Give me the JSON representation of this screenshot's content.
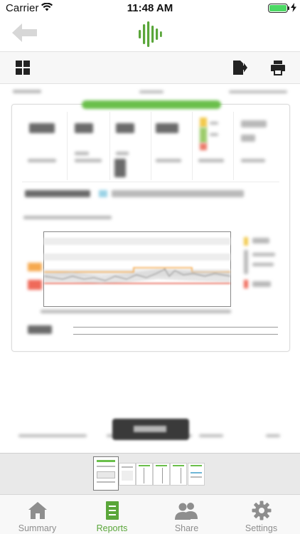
{
  "status_bar": {
    "carrier": "Carrier",
    "time": "11:48 AM",
    "battery_level": 1.0,
    "battery_color": "#4cd964"
  },
  "nav": {
    "back_icon": "back-arrow-icon",
    "logo_icon": "sound-bars-logo-icon",
    "logo_color": "#5aa63a"
  },
  "toolbar": {
    "grid_icon": "grid-view-icon",
    "export_icon": "export-document-icon",
    "print_icon": "printer-icon"
  },
  "document": {
    "blurred": true,
    "accent_color": "#6abf4b"
  },
  "thumbnails": {
    "count": 6,
    "selected_index": 0
  },
  "tabs": [
    {
      "label": "Summary",
      "icon": "home-icon",
      "active": false
    },
    {
      "label": "Reports",
      "icon": "report-document-icon",
      "active": true
    },
    {
      "label": "Share",
      "icon": "people-icon",
      "active": false
    },
    {
      "label": "Settings",
      "icon": "gear-icon",
      "active": false
    }
  ],
  "colors": {
    "active_tab": "#5aa63a",
    "inactive_tab": "#8e8e8e"
  }
}
